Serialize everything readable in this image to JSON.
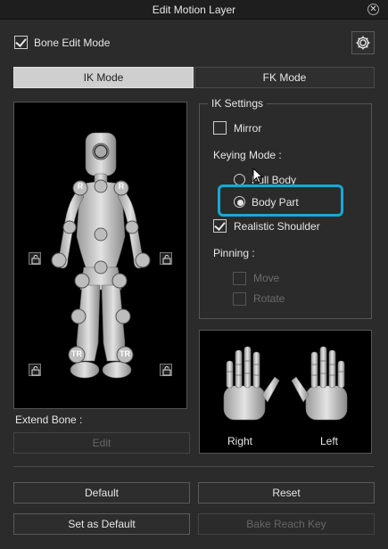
{
  "window": {
    "title": "Edit Motion Layer"
  },
  "bone_edit_mode": {
    "label": "Bone Edit Mode",
    "checked": true
  },
  "tabs": [
    {
      "label": "IK Mode",
      "active": true
    },
    {
      "label": "FK Mode",
      "active": false
    }
  ],
  "figure": {
    "markers": {
      "shoulder": "R",
      "foot": "TR"
    }
  },
  "ik_settings": {
    "title": "IK Settings",
    "mirror": {
      "label": "Mirror",
      "checked": false
    },
    "keying_mode_label": "Keying Mode :",
    "keying_options": [
      {
        "label": "Full Body",
        "selected": false
      },
      {
        "label": "Body Part",
        "selected": true
      }
    ],
    "realistic_shoulder": {
      "label": "Realistic Shoulder",
      "checked": true
    },
    "pinning_label": "Pinning :",
    "pinning_options": [
      {
        "label": "Move",
        "enabled": false
      },
      {
        "label": "Rotate",
        "enabled": false
      }
    ]
  },
  "hands": {
    "right_label": "Right",
    "left_label": "Left"
  },
  "extend_bone": {
    "label": "Extend Bone :",
    "button": "Edit"
  },
  "buttons": {
    "default": "Default",
    "reset": "Reset",
    "set_as_default": "Set as Default",
    "bake_reach_key": "Bake Reach Key"
  },
  "colors": {
    "highlight": "#17a8d6",
    "active_tab": "#cfcfcf"
  }
}
